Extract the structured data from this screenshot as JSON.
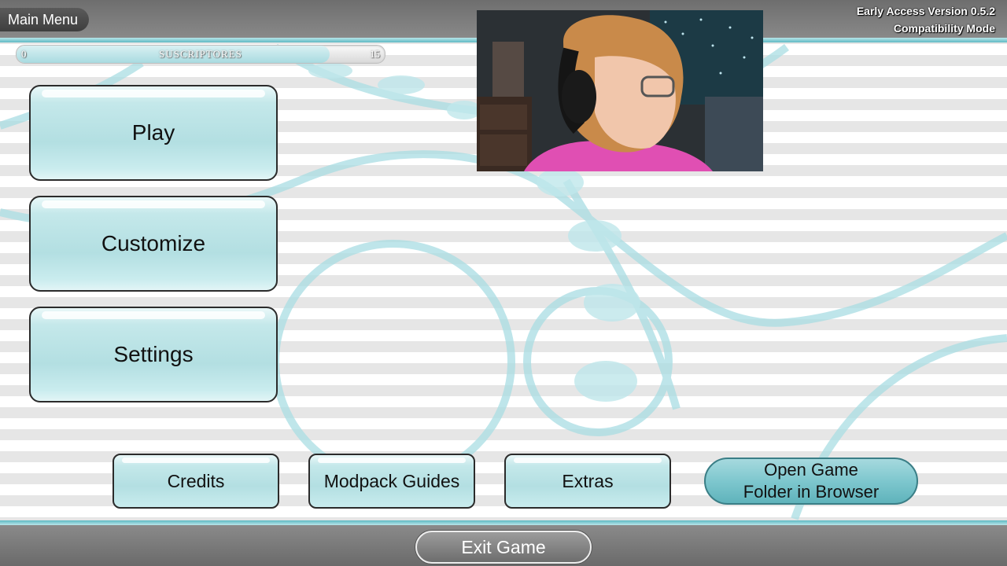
{
  "header": {
    "menu_title": "Main Menu",
    "version_line1": "Early Access Version 0.5.2",
    "version_line2": "Compatibility Mode"
  },
  "subscribers_bar": {
    "min": "0",
    "label": "SUSCRIPTORES",
    "max": "15",
    "fill_fraction": 0.85
  },
  "menu": {
    "play": "Play",
    "customize": "Customize",
    "settings": "Settings"
  },
  "secondary": {
    "credits": "Credits",
    "modpack_guides": "Modpack Guides",
    "extras": "Extras",
    "open_folder_line1": "Open Game",
    "open_folder_line2": "Folder in Browser"
  },
  "footer": {
    "exit": "Exit Game"
  },
  "colors": {
    "accent": "#5fb9c3",
    "button_fill": "#b3dfe2",
    "bar_gray": "#7a7a7a"
  }
}
